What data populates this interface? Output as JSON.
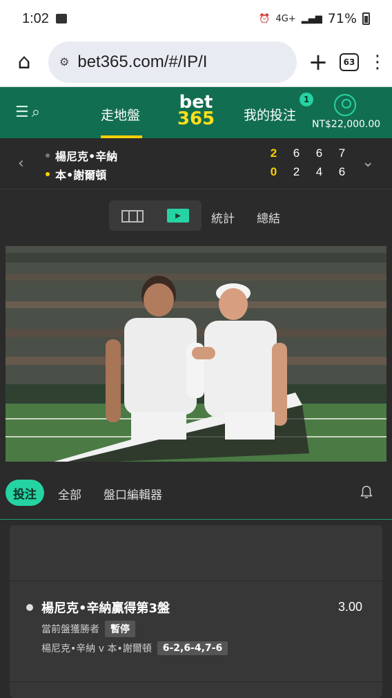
{
  "status_bar": {
    "time": "1:02",
    "network": "4G+",
    "battery": "71%"
  },
  "browser": {
    "url": "bet365.com/#/IP/I",
    "tab_count": "63"
  },
  "app": {
    "nav_live": "走地盤",
    "logo_top": "bet",
    "logo_bottom": "365",
    "nav_mybets": "我的投注",
    "mybets_badge": "1",
    "balance": "NT$22,000.00"
  },
  "score": {
    "players": [
      {
        "name": "楊尼克•辛納",
        "sets": [
          "2",
          "6",
          "6",
          "7"
        ],
        "serving": false
      },
      {
        "name": "本•謝爾頓",
        "sets": [
          "0",
          "2",
          "4",
          "6"
        ],
        "serving": true
      }
    ]
  },
  "view_tabs": {
    "stats": "統計",
    "summary": "總結"
  },
  "market_tabs": {
    "bet": "投注",
    "all": "全部",
    "editor": "盤口編輯器"
  },
  "bet_card": {
    "selection": "楊尼克•辛納贏得第3盤",
    "odds": "3.00",
    "market": "當前盤獲勝者",
    "status": "暫停",
    "match": "楊尼克•辛納 v 本•謝爾頓",
    "score": "6-2,6-4,7-6"
  },
  "colors": {
    "brand_green": "#126e51",
    "accent_yellow": "#ffdf1b",
    "accent_teal": "#26d3a3"
  }
}
